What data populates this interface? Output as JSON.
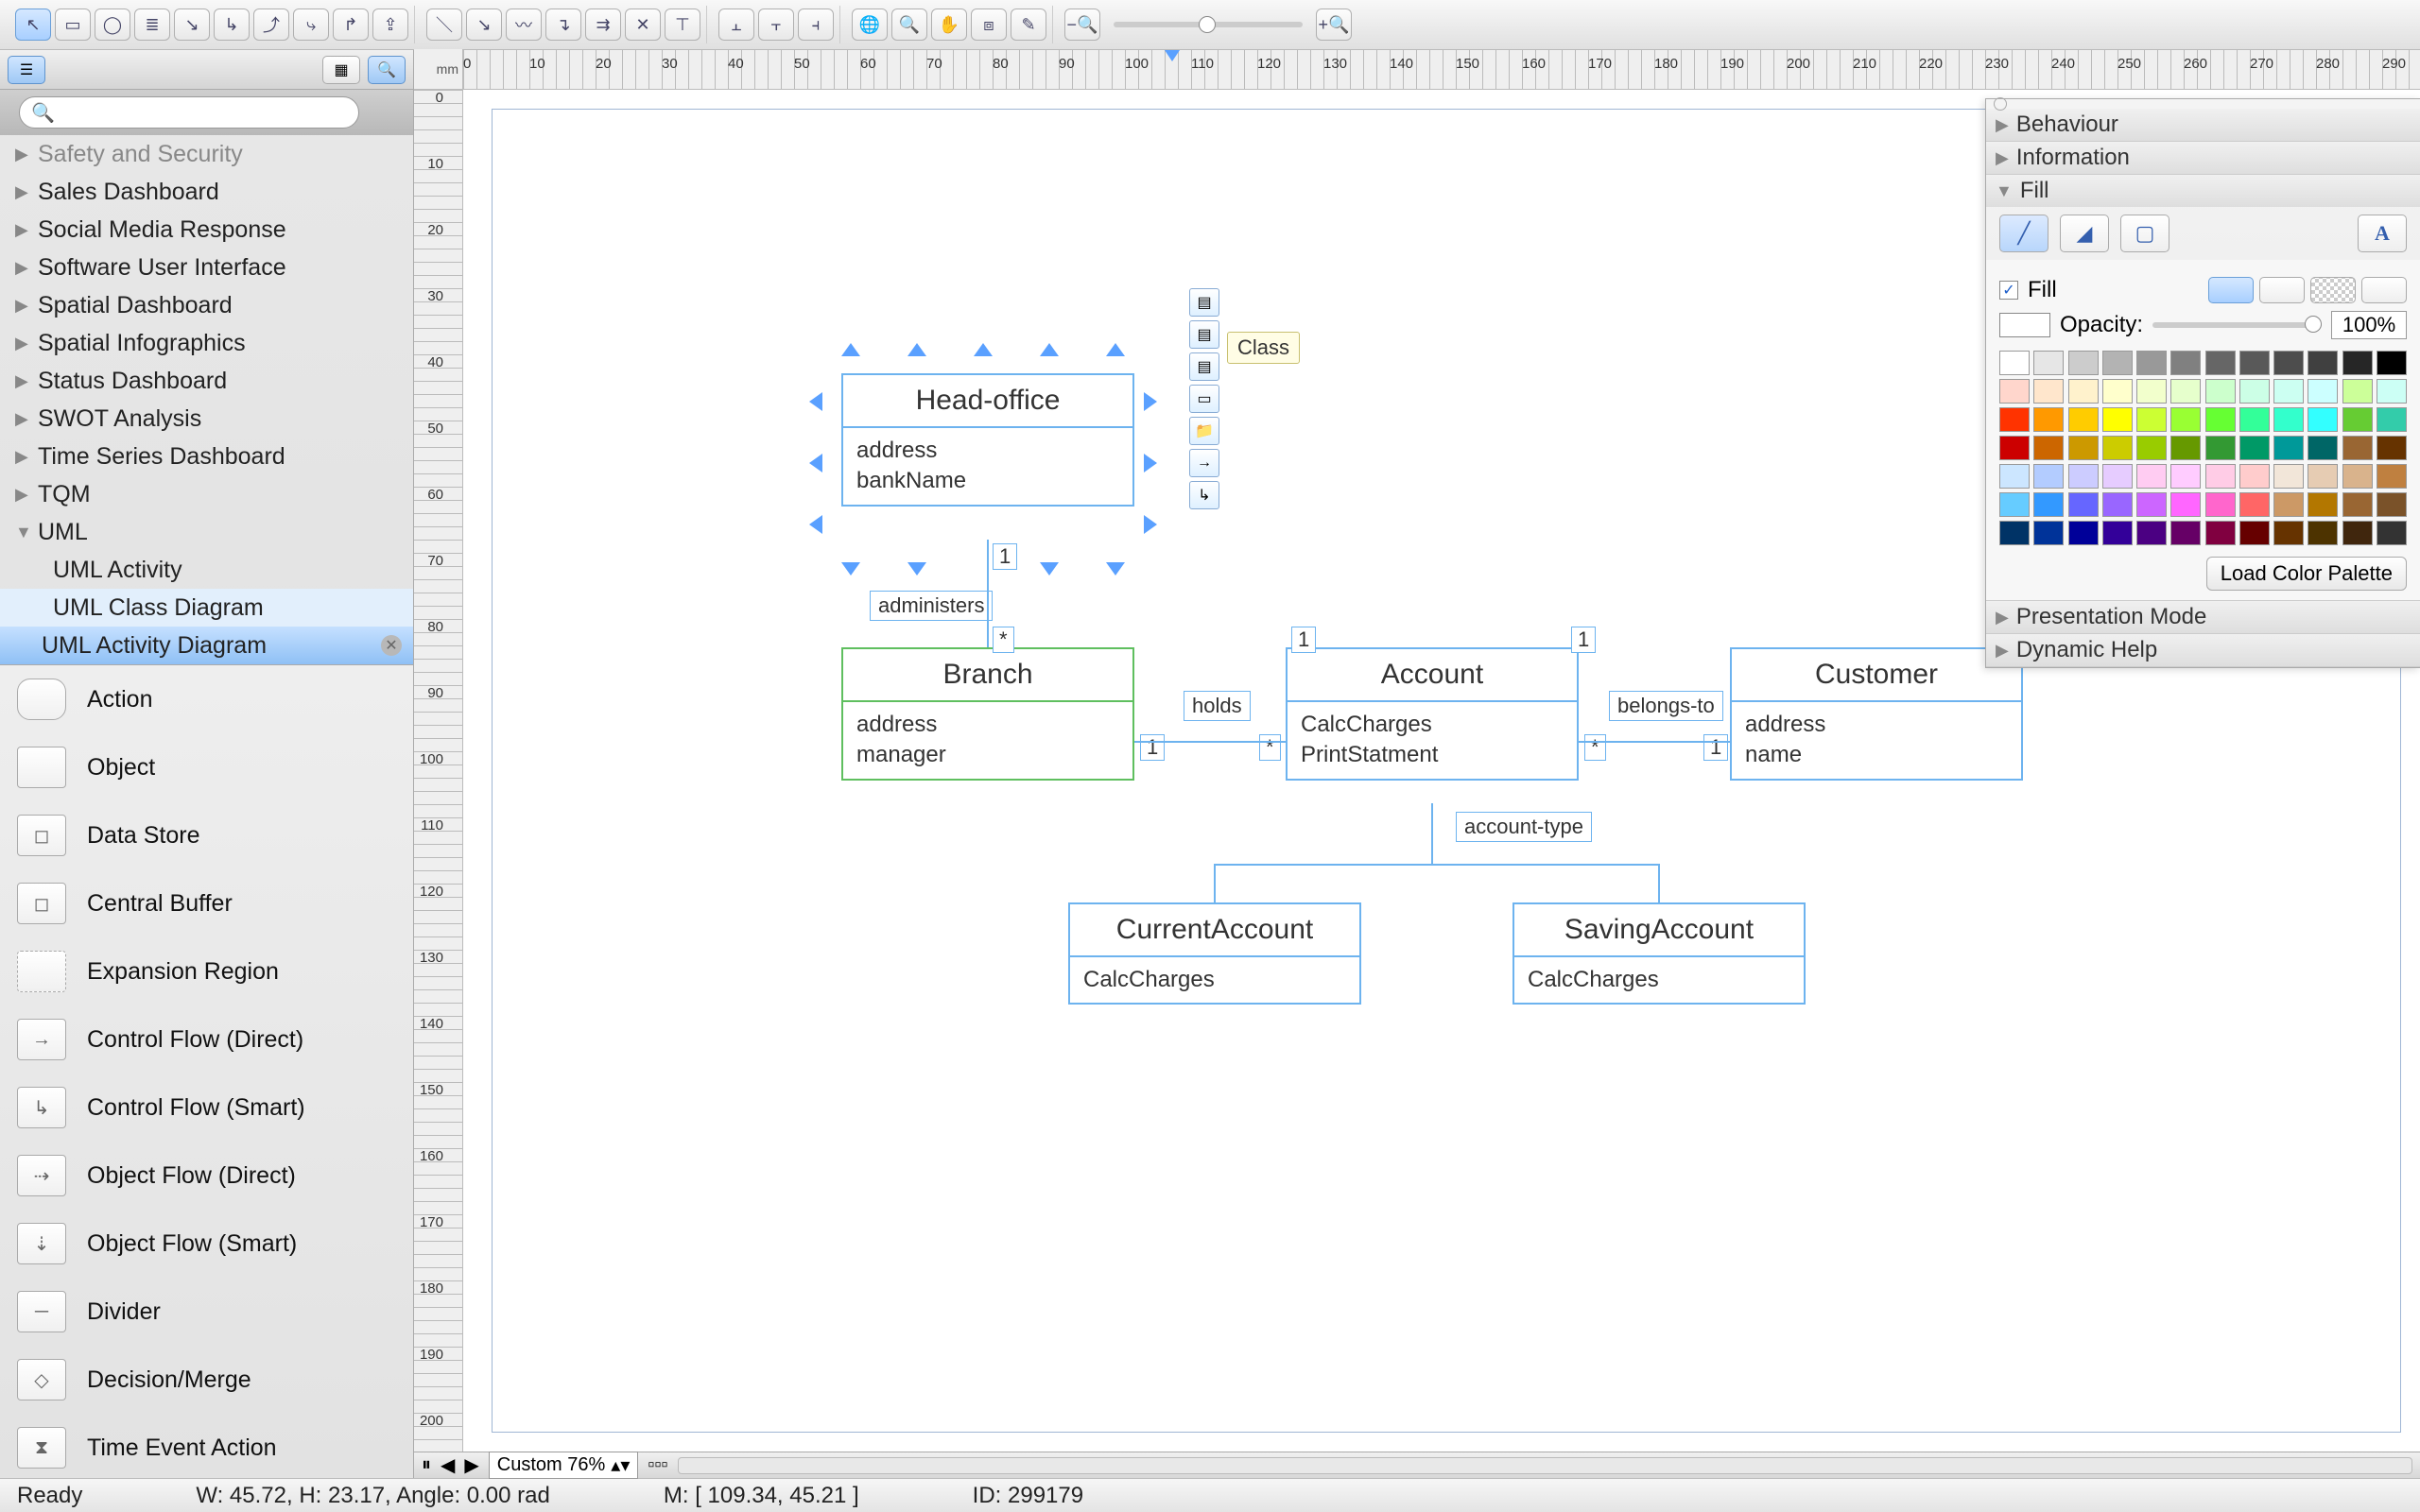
{
  "toolbar": {
    "groups": [
      [
        "cursor",
        "rect",
        "ellipse",
        "text",
        "connector1",
        "connector2",
        "connector3",
        "connector4",
        "connector5",
        "export"
      ],
      [
        "line1",
        "line2",
        "curve",
        "ortho",
        "multi",
        "cross",
        "tee"
      ],
      [
        "align1",
        "align2",
        "align3"
      ],
      [
        "globe",
        "zoom",
        "hand",
        "stamp",
        "wand"
      ]
    ]
  },
  "ruler_unit": "mm",
  "ruler_marker_pos_mm": 105,
  "sidebar": {
    "search_placeholder": "",
    "templates_cut": "Safety and Security",
    "templates": [
      {
        "label": "Sales Dashboard",
        "expanded": false
      },
      {
        "label": "Social Media Response",
        "expanded": false
      },
      {
        "label": "Software User Interface",
        "expanded": false
      },
      {
        "label": "Spatial Dashboard",
        "expanded": false
      },
      {
        "label": "Spatial Infographics",
        "expanded": false
      },
      {
        "label": "Status Dashboard",
        "expanded": false
      },
      {
        "label": "SWOT Analysis",
        "expanded": false
      },
      {
        "label": "Time Series Dashboard",
        "expanded": false
      },
      {
        "label": "TQM",
        "expanded": false
      },
      {
        "label": "UML",
        "expanded": true,
        "children": [
          {
            "label": "UML Activity"
          },
          {
            "label": "UML Class Diagram",
            "light": true
          },
          {
            "label": "UML Activity Diagram",
            "selected": true
          }
        ]
      }
    ],
    "shapes": [
      {
        "label": "Action",
        "glyph": "▭"
      },
      {
        "label": "Object",
        "glyph": "▭"
      },
      {
        "label": "Data Store",
        "glyph": "◻"
      },
      {
        "label": "Central Buffer",
        "glyph": "◻"
      },
      {
        "label": "Expansion Region",
        "glyph": "▭"
      },
      {
        "label": "Control Flow (Direct)",
        "glyph": "→"
      },
      {
        "label": "Control Flow (Smart)",
        "glyph": "↳"
      },
      {
        "label": "Object Flow (Direct)",
        "glyph": "⇢"
      },
      {
        "label": "Object Flow (Smart)",
        "glyph": "⇣"
      },
      {
        "label": "Divider",
        "glyph": "─"
      },
      {
        "label": "Decision/Merge",
        "glyph": "◇"
      },
      {
        "label": "Time Event Action",
        "glyph": "⧗"
      }
    ]
  },
  "diagram": {
    "tooltip": "Class",
    "classes": {
      "head_office": {
        "title": "Head-office",
        "attrs": [
          "address",
          "bankName"
        ]
      },
      "branch": {
        "title": "Branch",
        "attrs": [
          "address",
          "manager"
        ]
      },
      "account": {
        "title": "Account",
        "attrs": [
          "CalcCharges",
          "PrintStatment"
        ]
      },
      "customer": {
        "title": "Customer",
        "attrs": [
          "address",
          "name"
        ]
      },
      "current_account": {
        "title": "CurrentAccount",
        "attrs": [
          "CalcCharges"
        ]
      },
      "saving_account": {
        "title": "SavingAccount",
        "attrs": [
          "CalcCharges"
        ]
      }
    },
    "labels": {
      "administers": "administers",
      "holds": "holds",
      "belongs_to": "belongs-to",
      "account_type": "account-type"
    },
    "mults": {
      "one": "1",
      "star": "*"
    }
  },
  "inspector": {
    "sections": {
      "behaviour": "Behaviour",
      "information": "Information",
      "fill": "Fill",
      "presentation": "Presentation Mode",
      "dynamic": "Dynamic Help"
    },
    "fill_check": "Fill",
    "opacity_label": "Opacity:",
    "opacity_value": "100%",
    "load_palette": "Load Color Palette",
    "palette_colors": [
      "#ffffff",
      "#e6e6e6",
      "#cccccc",
      "#b3b3b3",
      "#999999",
      "#808080",
      "#666666",
      "#595959",
      "#4d4d4d",
      "#404040",
      "#262626",
      "#000000",
      "#ffd6cc",
      "#ffe6cc",
      "#fff2cc",
      "#ffffcc",
      "#f2ffcc",
      "#e6ffcc",
      "#ccffcc",
      "#ccffe6",
      "#ccfff2",
      "#ccffff",
      "#ccff99",
      "#ccfff5",
      "#ff3300",
      "#ff9900",
      "#ffcc00",
      "#ffff00",
      "#ccff33",
      "#99ff33",
      "#66ff33",
      "#33ff99",
      "#33ffcc",
      "#33ffff",
      "#66cc33",
      "#33ccaa",
      "#cc0000",
      "#cc6600",
      "#cc9900",
      "#cccc00",
      "#99cc00",
      "#669900",
      "#339933",
      "#009966",
      "#009999",
      "#006666",
      "#996633",
      "#663300",
      "#cce6ff",
      "#b3ccff",
      "#ccccff",
      "#e6ccff",
      "#ffccf2",
      "#ffccff",
      "#ffcce6",
      "#ffcccc",
      "#f2e6d9",
      "#e6ccb3",
      "#d9b38c",
      "#bf8040",
      "#66ccff",
      "#3399ff",
      "#6666ff",
      "#9966ff",
      "#cc66ff",
      "#ff66ff",
      "#ff66cc",
      "#ff6666",
      "#cc9966",
      "#b37700",
      "#996633",
      "#7a5229",
      "#003366",
      "#003399",
      "#000099",
      "#330099",
      "#4b0082",
      "#660066",
      "#800040",
      "#660000",
      "#663300",
      "#4d3300",
      "#40260d",
      "#333333"
    ]
  },
  "bottom": {
    "zoom_label": "Custom 76%"
  },
  "status": {
    "ready": "Ready",
    "dims": "W: 45.72,  H: 23.17,  Angle: 0.00 rad",
    "mouse": "M: [ 109.34, 45.21 ]",
    "id": "ID: 299179"
  }
}
